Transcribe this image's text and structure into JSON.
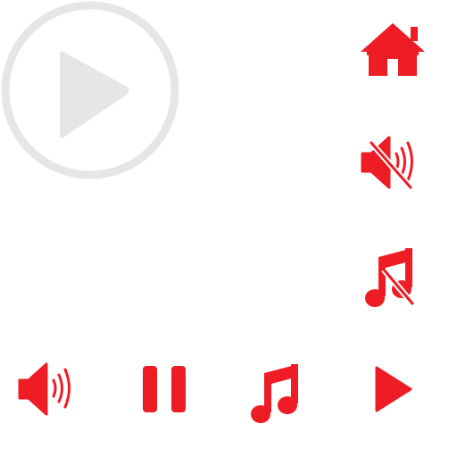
{
  "colors": {
    "accent": "#ee1c24",
    "muted": "#e6e6e6"
  },
  "icons": {
    "big_play": "play-circle",
    "home": "home",
    "mute": "volume-mute",
    "music_off": "music-off",
    "volume": "volume-up",
    "pause": "pause",
    "music": "music-note",
    "play": "play"
  }
}
